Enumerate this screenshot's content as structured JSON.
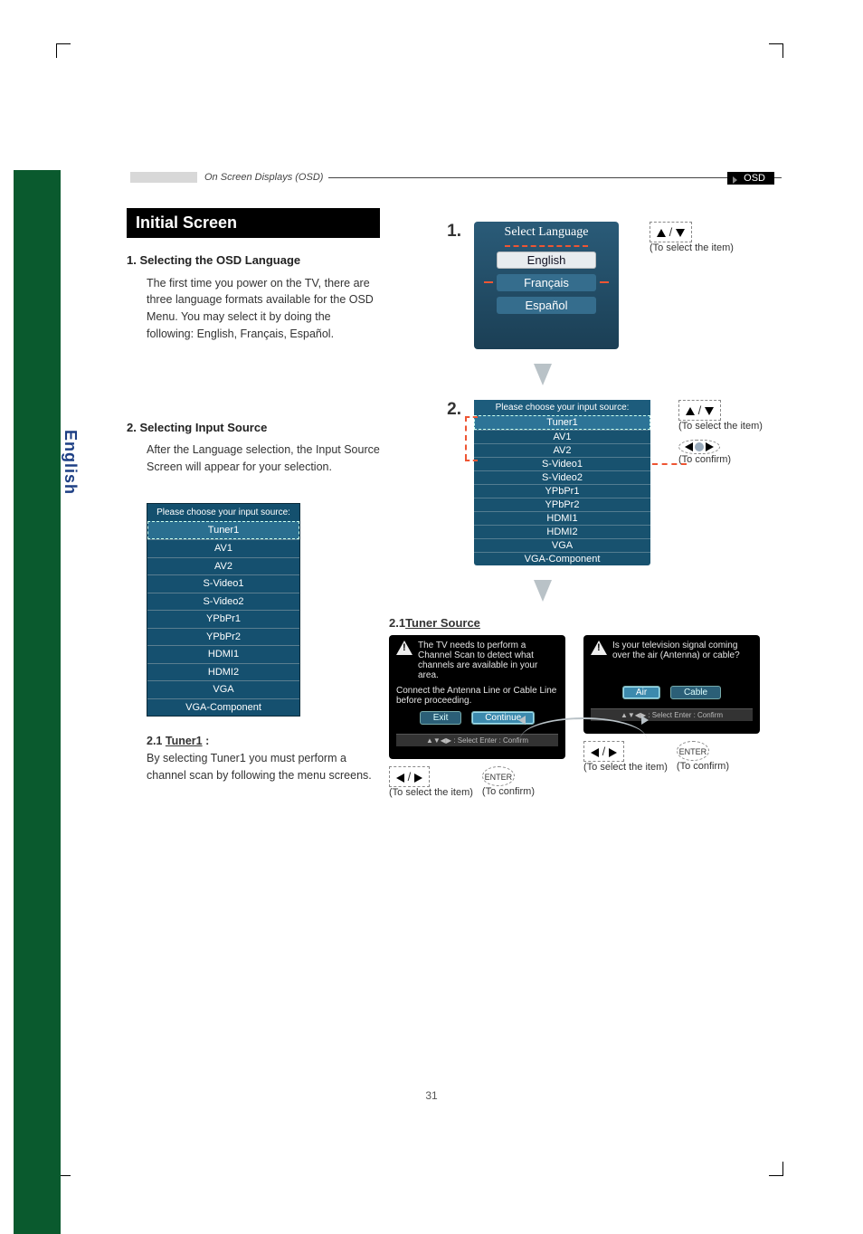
{
  "header": {
    "breadcrumb": "On Screen Displays (OSD)",
    "chip": "OSD"
  },
  "sidebar": {
    "lang_tab": "English"
  },
  "title": "Initial Screen",
  "page_number": "31",
  "s1": {
    "heading": "1.  Selecting the OSD Language",
    "body": "The first time you power on the TV, there are three language formats available for the OSD Menu. You may select it by doing the following: English, Français, Español."
  },
  "s2": {
    "heading": "2.  Selecting Input Source",
    "body": "After the Language selection, the Input Source Screen will appear for your selection.",
    "sub21_label": "2.1",
    "sub21_link": "Tuner1",
    "sub21_colon": ":",
    "sub21_body": "By selecting Tuner1 you must perform a channel scan by following the menu screens."
  },
  "input_list_header": "Please choose your input source:",
  "input_list": [
    "Tuner1",
    "AV1",
    "AV2",
    "S-Video1",
    "S-Video2",
    "YPbPr1",
    "YPbPr2",
    "HDMI1",
    "HDMI2",
    "VGA",
    "VGA-Component"
  ],
  "step1": {
    "num": "1.",
    "panel_title": "Select Language",
    "opts": [
      "English",
      "Français",
      "Español"
    ],
    "hint": "(To select the item)"
  },
  "step2": {
    "num": "2.",
    "hint_select": "(To select the item)",
    "hint_confirm": "(To confirm)"
  },
  "sec21": {
    "heading_prefix": "2.1 ",
    "heading_link": "Tuner Source",
    "left_box": {
      "line1": "The TV needs to perform a Channel Scan to detect what channels are available in your area.",
      "line2": "Connect the Antenna Line or Cable Line before proceeding.",
      "btn_exit": "Exit",
      "btn_continue": "Continue",
      "footer": "▲▼◀▶ : Select    Enter : Confirm"
    },
    "right_box": {
      "line1": "Is your television signal coming over the air (Antenna) or cable?",
      "btn_air": "Air",
      "btn_cable": "Cable",
      "footer": "▲▼◀▶ : Select    Enter : Confirm"
    },
    "hint_select": "(To select the item)",
    "hint_confirm": "(To confirm)",
    "enter_label": "ENTER"
  }
}
